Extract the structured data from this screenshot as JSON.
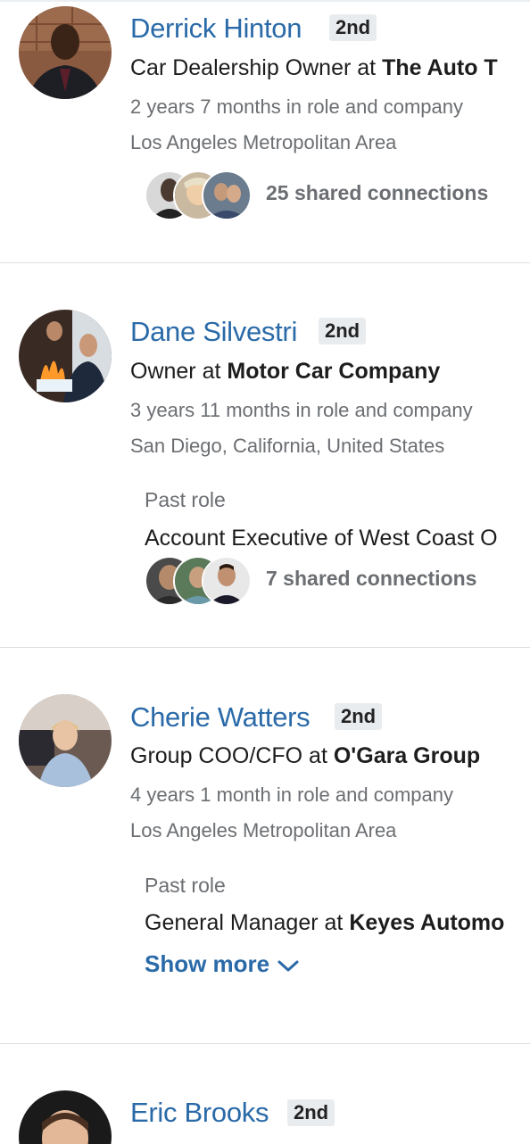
{
  "degree_badge": "2nd",
  "results": [
    {
      "name": "Derrick Hinton",
      "degree": "2nd",
      "role": "Car Dealership Owner",
      "at": "at",
      "company": "The Auto T",
      "tenure": "2 years 7 months in role and company",
      "location": "Los Angeles Metropolitan Area",
      "shared": "25 shared connections"
    },
    {
      "name": "Dane Silvestri",
      "degree": "2nd",
      "role": "Owner",
      "at": "at",
      "company": "Motor Car Company",
      "tenure": "3 years 11 months in role and company",
      "location": "San Diego, California, United States",
      "past_label": "Past role",
      "past_role": "Account Executive of West Coast O",
      "shared": "7 shared connections"
    },
    {
      "name": "Cherie Watters",
      "degree": "2nd",
      "role": "Group COO/CFO",
      "at": "at",
      "company": "O'Gara Group",
      "tenure": "4 years 1 month in role and company",
      "location": "Los Angeles Metropolitan Area",
      "past_label": "Past role",
      "past_role": "General Manager",
      "past_at": "at",
      "past_company": "Keyes Automo",
      "show_more": "Show more"
    },
    {
      "name": "Eric Brooks",
      "degree": "2nd"
    }
  ],
  "icons": {
    "chevron": "chevron-down-icon"
  },
  "colors": {
    "link": "#2a6aa8",
    "muted": "#6b6e72",
    "badge_bg": "#e9ecef",
    "divider": "#dcdfe3"
  }
}
